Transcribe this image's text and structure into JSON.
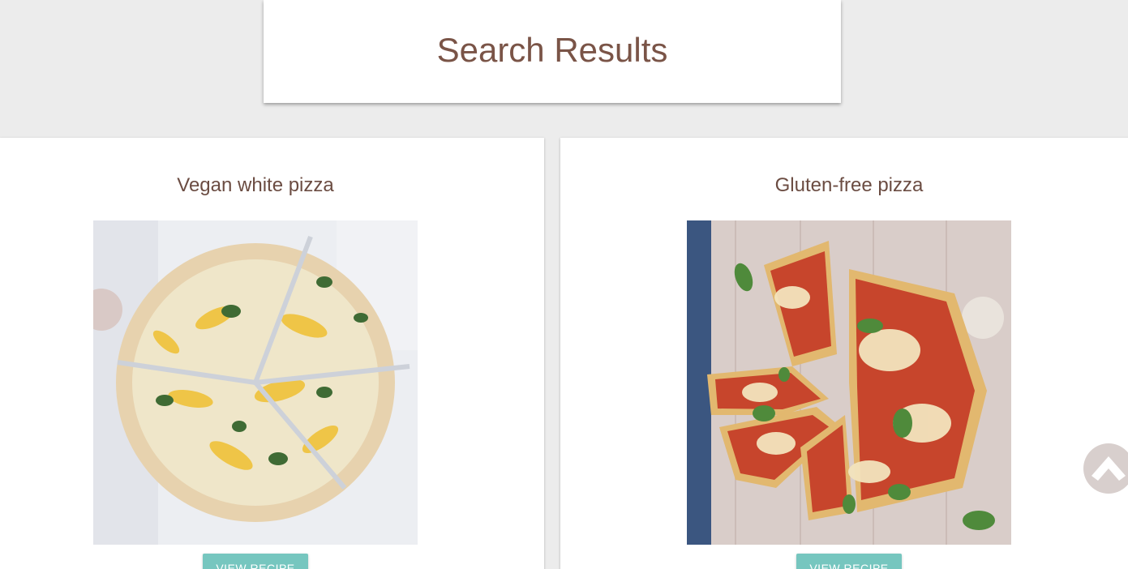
{
  "header": {
    "title": "Search Results"
  },
  "results": [
    {
      "title": "Vegan white pizza",
      "image": "vegan-white-pizza-photo",
      "button_label": "VIEW RECIPE"
    },
    {
      "title": "Gluten-free pizza",
      "image": "gluten-free-pizza-photo",
      "button_label": "VIEW RECIPE"
    }
  ],
  "scroll_top": {
    "icon": "chevron-up-icon"
  },
  "colors": {
    "page_background": "#ececec",
    "title_text": "#7a5447",
    "button": "#76c6bf",
    "scroll_button": "#d8cfcd"
  }
}
